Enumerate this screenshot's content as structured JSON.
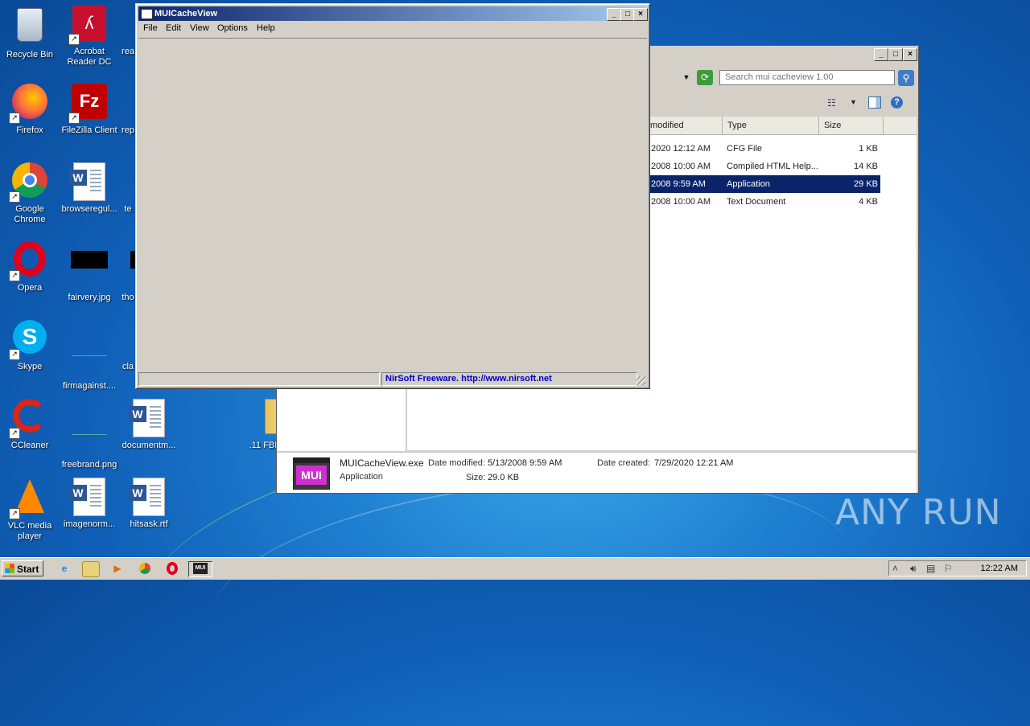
{
  "desktop": {
    "icons": [
      {
        "label": "Recycle Bin"
      },
      {
        "label": "Acrobat Reader DC"
      },
      {
        "label": "rea"
      },
      {
        "label": "Firefox"
      },
      {
        "label": "FileZilla Client"
      },
      {
        "label": "rep"
      },
      {
        "label": "Google Chrome"
      },
      {
        "label": "browseregul..."
      },
      {
        "label": "te"
      },
      {
        "label": "Opera"
      },
      {
        "label": "fairvery.jpg"
      },
      {
        "label": "tho"
      },
      {
        "label": "Skype"
      },
      {
        "label": "firmagainst...."
      },
      {
        "label": "cla"
      },
      {
        "label": "CCleaner"
      },
      {
        "label": "freebrand.png"
      },
      {
        "label": "documentm..."
      },
      {
        "label": ".11 FBI"
      },
      {
        "label": "VLC media player"
      },
      {
        "label": "imagenorm..."
      },
      {
        "label": "hitsask.rtf"
      }
    ]
  },
  "explorer": {
    "search_placeholder": "Search mui cacheview 1.00",
    "columns": [
      "modified",
      "Type",
      "Size"
    ],
    "rows": [
      {
        "modified": "2020 12:12 AM",
        "type": "CFG File",
        "size": "1 KB"
      },
      {
        "modified": "2008 10:00 AM",
        "type": "Compiled HTML Help...",
        "size": "14 KB"
      },
      {
        "modified": "2008 9:59 AM",
        "type": "Application",
        "size": "29 KB"
      },
      {
        "modified": "2008 10:00 AM",
        "type": "Text Document",
        "size": "4 KB"
      }
    ],
    "details": {
      "filename": "MUICacheView.exe",
      "kind": "Application",
      "date_modified_label": "Date modified:",
      "date_modified": "5/13/2008 9:59 AM",
      "size_label": "Size:",
      "size": "29.0 KB",
      "date_created_label": "Date created:",
      "date_created": "7/29/2020 12:21 AM",
      "icon_text": "MUI"
    }
  },
  "muiwin": {
    "title": "MUICacheView",
    "menu": [
      "File",
      "Edit",
      "View",
      "Options",
      "Help"
    ],
    "status_link": "NirSoft Freeware.  http://www.nirsoft.net"
  },
  "taskbar": {
    "start_label": "Start",
    "clock": "12:22 AM",
    "mui_button_text": "MUI"
  },
  "watermark": "ANY RUN",
  "colors": {
    "titlebar_start": "#0a246a",
    "titlebar_end": "#a6caf0",
    "selection": "#0a246a",
    "status_link": "#0000cc"
  }
}
